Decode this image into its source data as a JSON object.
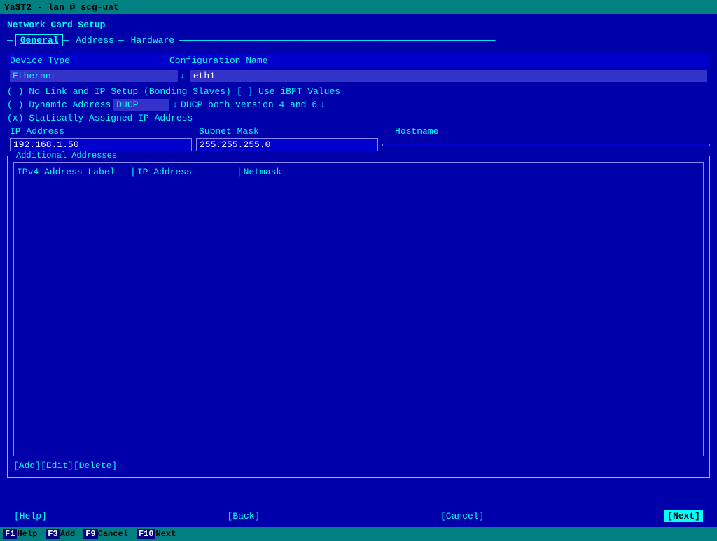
{
  "titlebar": {
    "text": "YaST2 - lan @ scg-uat"
  },
  "page": {
    "title": "Network Card Setup"
  },
  "tabs": {
    "general_label": "General",
    "address_label": "Address",
    "hardware_label": "Hardware"
  },
  "form": {
    "device_type_label": "Device Type",
    "device_type_value": "Ethernet",
    "config_name_label": "Configuration Name",
    "config_name_value": "eth1",
    "radio_no_link": "( ) No Link and IP Setup (Bonding Slaves)",
    "ibft_checkbox": "[ ] Use iBFT Values",
    "radio_dynamic": "( ) Dynamic Address",
    "dhcp_value": "DHCP",
    "dhcp_description": "DHCP both version 4 and 6",
    "radio_static": "(x) Statically Assigned IP Address",
    "ip_address_label": "IP Address",
    "subnet_mask_label": "Subnet Mask",
    "hostname_label": "Hostname",
    "ip_address_value": "192.168.1.50",
    "subnet_mask_value": "255.255.255.0",
    "hostname_value": ""
  },
  "additional_addresses": {
    "section_title": "Additional Addresses",
    "table_headers": {
      "label": "IPv4 Address Label",
      "ip": "IP Address",
      "netmask": "Netmask"
    },
    "rows": [],
    "add_btn": "[Add]",
    "edit_btn": "[Edit]",
    "delete_btn": "[Delete]"
  },
  "action_bar": {
    "help_btn": "[Help]",
    "back_btn": "[Back]",
    "cancel_btn": "[Cancel]",
    "next_btn": "[Next]"
  },
  "fkeys": [
    {
      "key": "F1",
      "label": "Help"
    },
    {
      "key": "F3",
      "label": "Add"
    },
    {
      "key": "F9",
      "label": "Cancel"
    },
    {
      "key": "F10",
      "label": "Next"
    }
  ]
}
